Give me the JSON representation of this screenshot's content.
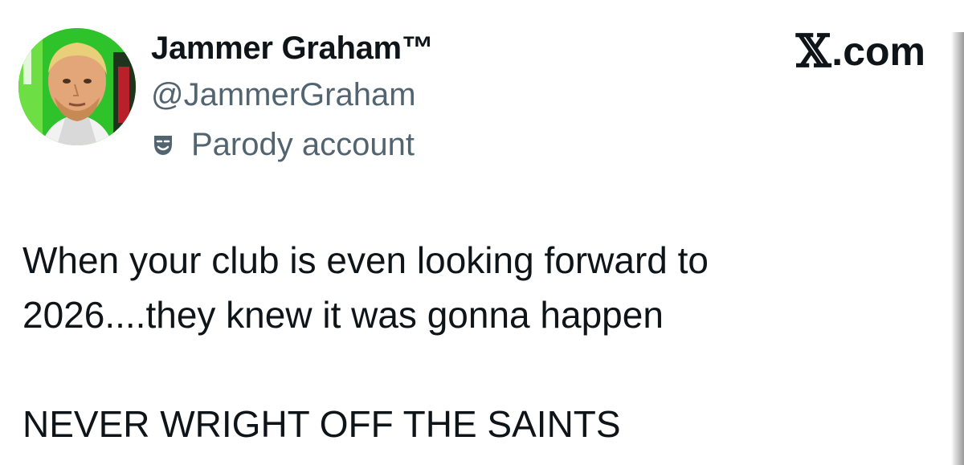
{
  "author": {
    "display_name": "Jammer Graham™",
    "handle": "@JammerGraham",
    "account_label": "Parody account",
    "account_label_icon": "theater-masks-icon",
    "avatar": "profile-photo"
  },
  "brand": {
    "logo_letter": "𝕏",
    "logo_suffix": ".com"
  },
  "post": {
    "line_1": "When your club is even looking forward to",
    "line_2": "2026....they knew it was gonna happen",
    "line_3": "NEVER WRIGHT OFF THE SAINTS"
  },
  "colors": {
    "text_primary": "#0f1419",
    "text_secondary": "#536471",
    "avatar_background": "#2ec32a",
    "background": "#ffffff"
  }
}
